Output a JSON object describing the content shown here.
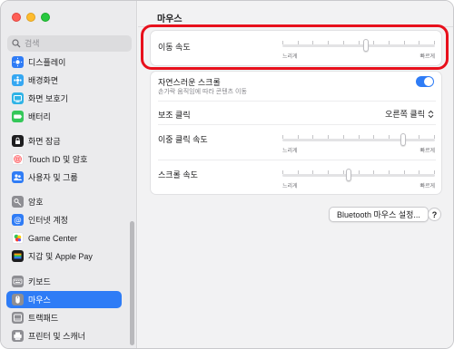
{
  "sidebar": {
    "search_placeholder": "검색",
    "items": [
      {
        "label": "디스플레이",
        "icon": "display-icon",
        "color": "#2f7cf6"
      },
      {
        "label": "배경화면",
        "icon": "wallpaper-icon",
        "color": "#35a7f2"
      },
      {
        "label": "화면 보호기",
        "icon": "screensaver-icon",
        "color": "#2fb3e6"
      },
      {
        "label": "배터리",
        "icon": "battery-icon",
        "color": "#34c759"
      },
      {
        "label": "화면 잠금",
        "icon": "lock-screen-icon",
        "color": "#1d1d1f"
      },
      {
        "label": "Touch ID 및 암호",
        "icon": "fingerprint-icon",
        "color": "#ff5a5f"
      },
      {
        "label": "사용자 및 그룹",
        "icon": "users-icon",
        "color": "#2f7cf6"
      },
      {
        "label": "암호",
        "icon": "key-icon",
        "color": "#8e8e93"
      },
      {
        "label": "인터넷 계정",
        "icon": "at-sign-icon",
        "color": "#2f7cf6"
      },
      {
        "label": "Game Center",
        "icon": "game-center-icon",
        "color": "#ffffff"
      },
      {
        "label": "지갑 및 Apple Pay",
        "icon": "wallet-icon",
        "color": "#1d1d1f"
      },
      {
        "label": "키보드",
        "icon": "keyboard-icon",
        "color": "#8e8e93"
      },
      {
        "label": "마우스",
        "icon": "mouse-icon",
        "color": "#8e8e93"
      },
      {
        "label": "트랙패드",
        "icon": "trackpad-icon",
        "color": "#8e8e93"
      },
      {
        "label": "프린터 및 스캐너",
        "icon": "printer-icon",
        "color": "#8e8e93"
      }
    ],
    "selected": "마우스"
  },
  "main": {
    "title": "마우스",
    "tracking_speed": {
      "label": "이동 속도",
      "slow": "느리게",
      "fast": "빠르게",
      "value": 0.55
    },
    "natural_scroll": {
      "label": "자연스러운 스크롤",
      "description": "손가락 움직임에 따라 콘텐츠 이동",
      "on": true
    },
    "secondary_click": {
      "label": "보조 클릭",
      "value": "오른쪽 클릭"
    },
    "double_click_speed": {
      "label": "이중 클릭 속도",
      "slow": "느리게",
      "fast": "빠르게",
      "value": 0.8
    },
    "scroll_speed": {
      "label": "스크롤 속도",
      "slow": "느리게",
      "fast": "빠르게",
      "value": 0.43
    },
    "bluetooth_button": "Bluetooth 마우스 설정...",
    "help_button": "?"
  },
  "colors": {
    "accent": "#2e7cf6",
    "highlight": "#e8101c"
  }
}
